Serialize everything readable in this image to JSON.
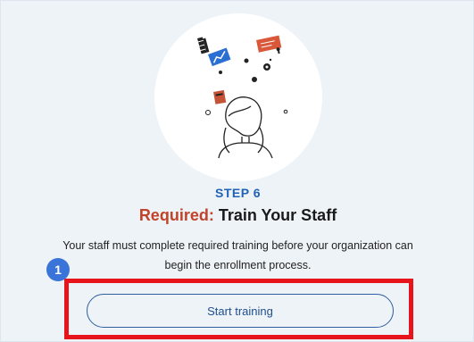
{
  "step": {
    "label": "STEP 6",
    "label_color": "#1f62b8",
    "badge_number": "1"
  },
  "title": {
    "required_prefix": "Required:",
    "main": " Train Your Staff"
  },
  "description": {
    "line1": "Your staff must complete required training before your organization can",
    "line2": "begin the enrollment process."
  },
  "actions": {
    "start_label": "Start training"
  },
  "colors": {
    "accent_red": "#c0432a",
    "highlight_red": "#e8141b",
    "badge_blue": "#3b74d8",
    "button_border": "#2f5f9e"
  }
}
